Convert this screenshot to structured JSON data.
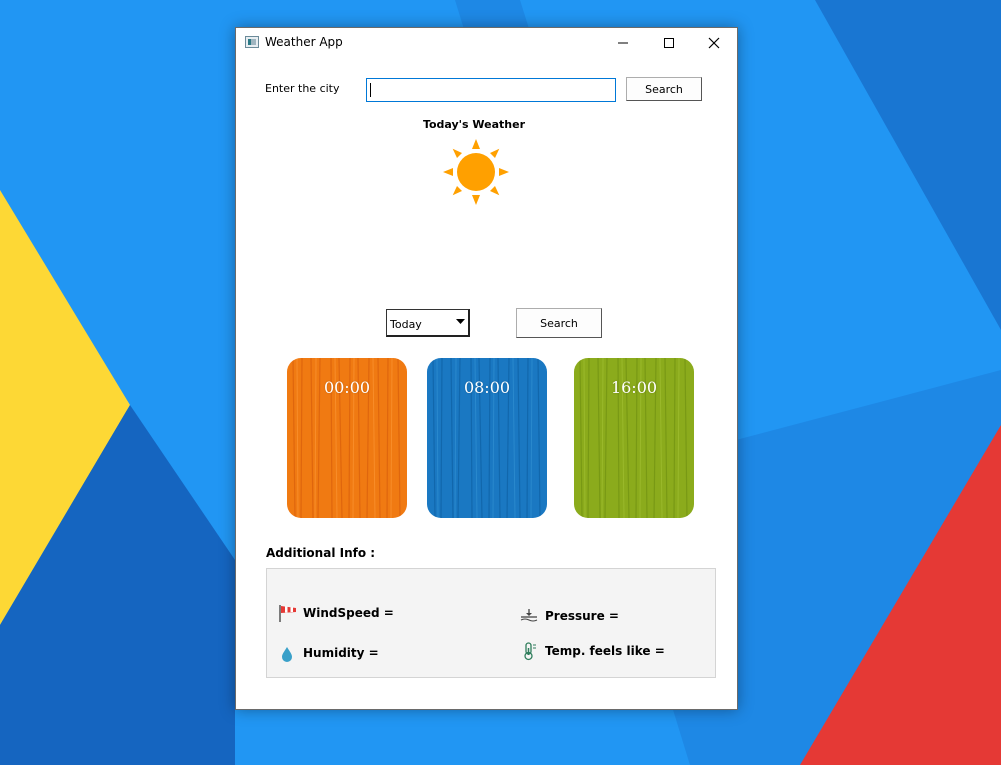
{
  "window": {
    "title": "Weather App"
  },
  "search": {
    "label": "Enter the city",
    "value": "",
    "button_label": "Search"
  },
  "weather": {
    "heading": "Today's Weather",
    "icon": "sun-icon"
  },
  "forecast": {
    "selected_day": "Today",
    "button_label": "Search",
    "cards": [
      {
        "time": "00:00",
        "color": "#f07a12"
      },
      {
        "time": "08:00",
        "color": "#1a78c2"
      },
      {
        "time": "16:00",
        "color": "#8bab1c"
      }
    ]
  },
  "additional": {
    "heading": "Additional Info :",
    "wind_speed": "WindSpeed =",
    "humidity": "Humidity =",
    "pressure": "Pressure =",
    "feels_like": "Temp. feels like ="
  },
  "colors": {
    "desktop_blue": "#2196f3",
    "desktop_dark_blue": "#1565c0",
    "desktop_yellow": "#fdd835",
    "desktop_red": "#e53935",
    "input_focus": "#0078d7",
    "sun": "#ffa000"
  }
}
